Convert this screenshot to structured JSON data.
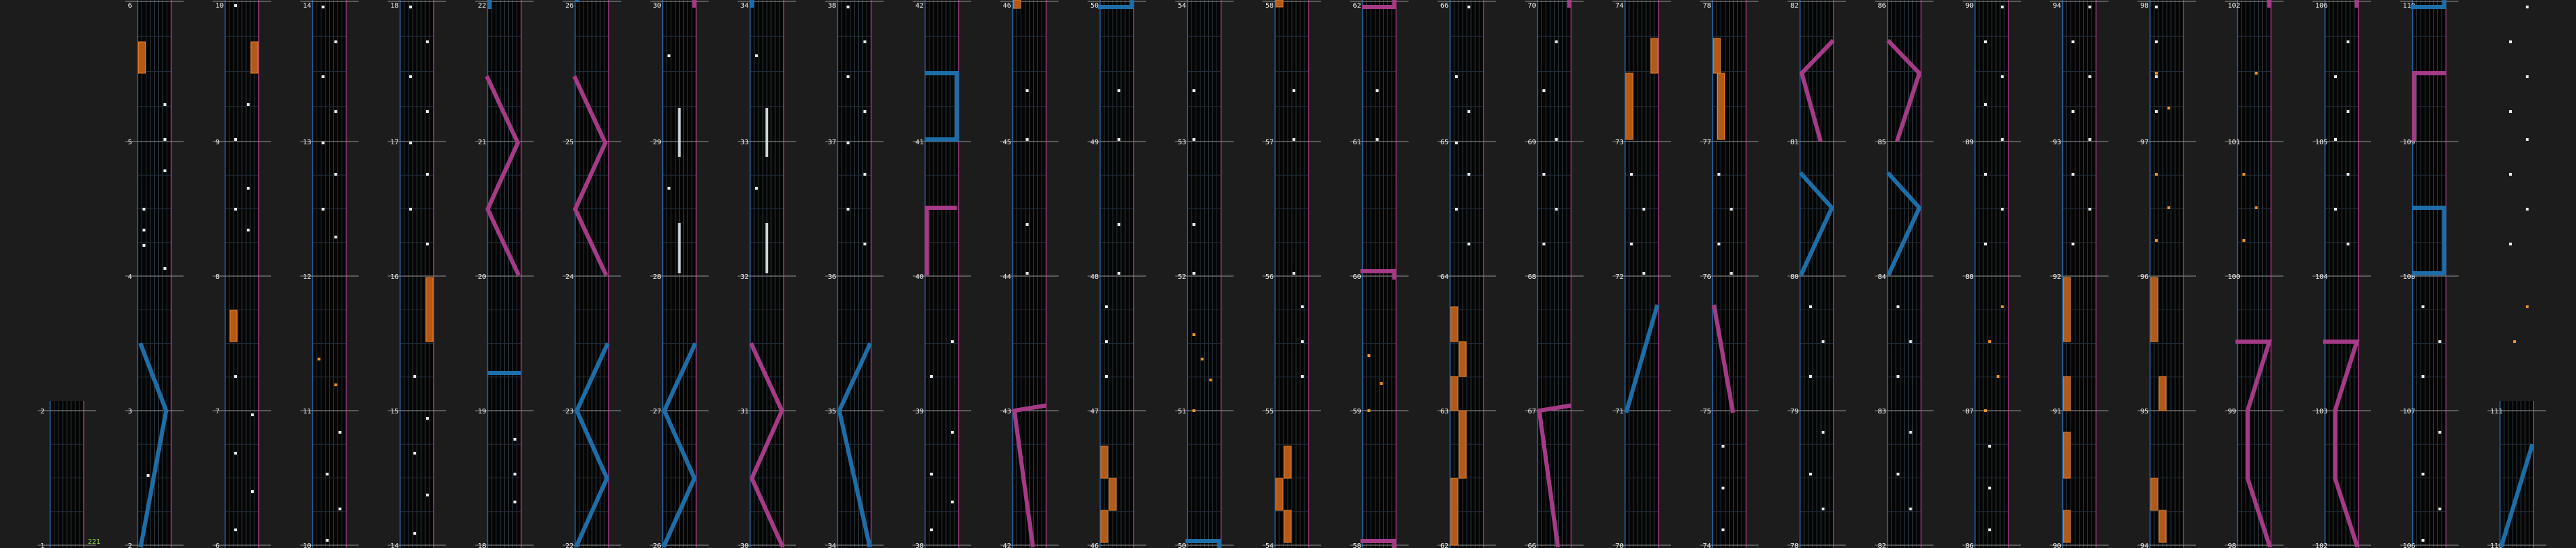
{
  "combo_label": "221",
  "columns": [
    {
      "labels": [
        "",
        "",
        "",
        "2",
        "1"
      ]
    },
    {
      "labels": [
        "6",
        "5",
        "4",
        "3",
        "2"
      ]
    },
    {
      "labels": [
        "10",
        "9",
        "8",
        "7",
        "6"
      ]
    },
    {
      "labels": [
        "14",
        "13",
        "12",
        "11",
        "10"
      ]
    },
    {
      "labels": [
        "18",
        "17",
        "16",
        "15",
        "14"
      ]
    },
    {
      "labels": [
        "22",
        "21",
        "20",
        "19",
        "18"
      ]
    },
    {
      "labels": [
        "26",
        "25",
        "24",
        "23",
        "22"
      ]
    },
    {
      "labels": [
        "30",
        "29",
        "28",
        "27",
        "26"
      ]
    },
    {
      "labels": [
        "34",
        "33",
        "32",
        "31",
        "30"
      ]
    },
    {
      "labels": [
        "38",
        "37",
        "36",
        "35",
        "34"
      ]
    },
    {
      "labels": [
        "42",
        "41",
        "40",
        "39",
        "38"
      ]
    },
    {
      "labels": [
        "46",
        "45",
        "44",
        "43",
        "42"
      ]
    },
    {
      "labels": [
        "50",
        "49",
        "48",
        "47",
        "46"
      ]
    },
    {
      "labels": [
        "54",
        "53",
        "52",
        "51",
        "50"
      ]
    },
    {
      "labels": [
        "58",
        "57",
        "56",
        "55",
        "54"
      ]
    },
    {
      "labels": [
        "62",
        "61",
        "60",
        "59",
        "58"
      ]
    },
    {
      "labels": [
        "66",
        "65",
        "64",
        "63",
        "62"
      ]
    },
    {
      "labels": [
        "70",
        "69",
        "68",
        "67",
        "66"
      ]
    },
    {
      "labels": [
        "74",
        "73",
        "72",
        "71",
        "70"
      ]
    },
    {
      "labels": [
        "78",
        "77",
        "76",
        "75",
        "74"
      ]
    },
    {
      "labels": [
        "82",
        "81",
        "80",
        "79",
        "78"
      ]
    },
    {
      "labels": [
        "86",
        "85",
        "84",
        "83",
        "82"
      ]
    },
    {
      "labels": [
        "90",
        "89",
        "88",
        "87",
        "86"
      ]
    },
    {
      "labels": [
        "94",
        "93",
        "92",
        "91",
        "90"
      ]
    },
    {
      "labels": [
        "98",
        "97",
        "96",
        "95",
        "94"
      ]
    },
    {
      "labels": [
        "102",
        "101",
        "100",
        "99",
        "98"
      ]
    },
    {
      "labels": [
        "106",
        "105",
        "104",
        "103",
        "102"
      ]
    },
    {
      "labels": [
        "110",
        "109",
        "108",
        "107",
        "106"
      ]
    },
    {
      "labels": [
        "",
        "",
        "",
        "111",
        "110"
      ]
    }
  ]
}
